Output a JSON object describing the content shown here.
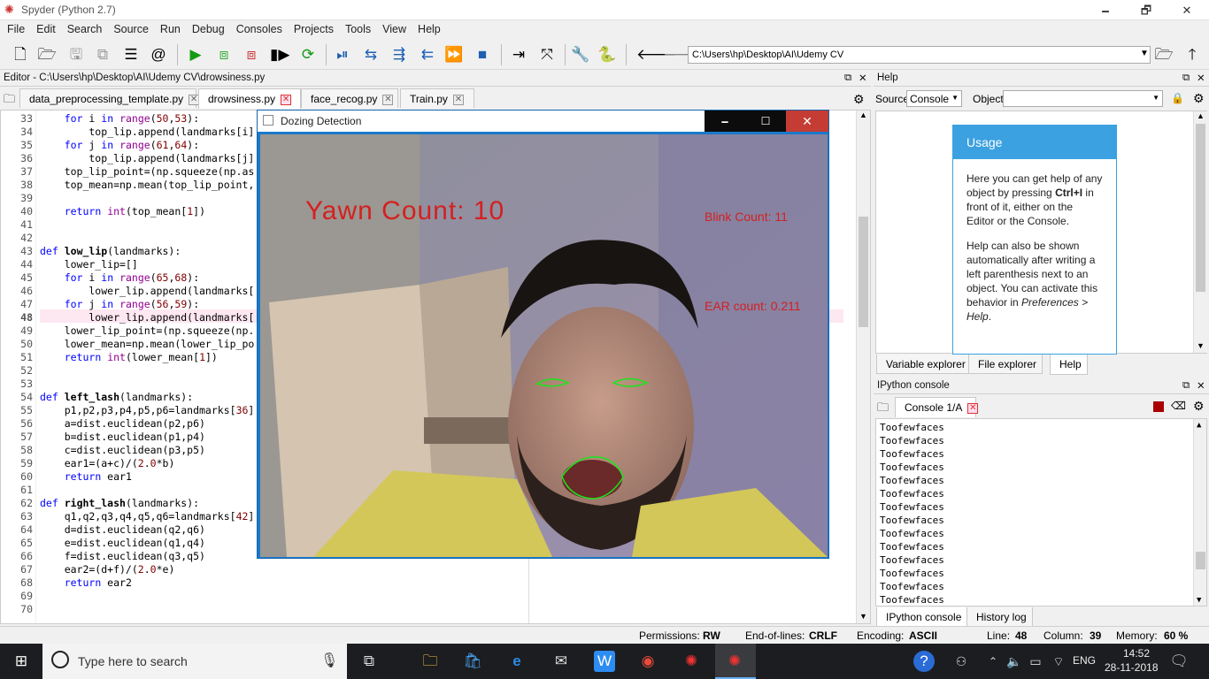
{
  "window": {
    "title": "Spyder (Python 2.7)",
    "minimize": "🗕",
    "maximize": "🗗",
    "close": "✕"
  },
  "menu": [
    "File",
    "Edit",
    "Search",
    "Source",
    "Run",
    "Debug",
    "Consoles",
    "Projects",
    "Tools",
    "View",
    "Help"
  ],
  "toolbar": {
    "path": "C:\\Users\\hp\\Desktop\\AI\\Udemy CV"
  },
  "editor": {
    "header": "Editor - C:\\Users\\hp\\Desktop\\AI\\Udemy CV\\drowsiness.py",
    "tabs": [
      "data_preprocessing_template.py",
      "drowsiness.py",
      "face_recog.py",
      "Train.py"
    ],
    "active_tab": 1,
    "current_line": 48,
    "lines": [
      {
        "n": "33",
        "t": "    for i in range(50,53):"
      },
      {
        "n": "34",
        "t": "        top_lip.append(landmarks[i]"
      },
      {
        "n": "35",
        "t": "    for j in range(61,64):"
      },
      {
        "n": "36",
        "t": "        top_lip.append(landmarks[j]"
      },
      {
        "n": "37",
        "t": "    top_lip_point=(np.squeeze(np.as"
      },
      {
        "n": "38",
        "t": "    top_mean=np.mean(top_lip_point,"
      },
      {
        "n": "39",
        "t": ""
      },
      {
        "n": "40",
        "t": "    return int(top_mean[1])"
      },
      {
        "n": "41",
        "t": ""
      },
      {
        "n": "42",
        "t": ""
      },
      {
        "n": "43",
        "t": "def low_lip(landmarks):"
      },
      {
        "n": "44",
        "t": "    lower_lip=[]"
      },
      {
        "n": "45",
        "t": "    for i in range(65,68):"
      },
      {
        "n": "46",
        "t": "        lower_lip.append(landmarks["
      },
      {
        "n": "47",
        "t": "    for j in range(56,59):"
      },
      {
        "n": "48",
        "t": "        lower_lip.append(landmarks["
      },
      {
        "n": "49",
        "t": "    lower_lip_point=(np.squeeze(np."
      },
      {
        "n": "50",
        "t": "    lower_mean=np.mean(lower_lip_po"
      },
      {
        "n": "51",
        "t": "    return int(lower_mean[1])"
      },
      {
        "n": "52",
        "t": ""
      },
      {
        "n": "53",
        "t": ""
      },
      {
        "n": "54",
        "t": "def left_lash(landmarks):"
      },
      {
        "n": "55",
        "t": "    p1,p2,p3,p4,p5,p6=landmarks[36]"
      },
      {
        "n": "56",
        "t": "    a=dist.euclidean(p2,p6)"
      },
      {
        "n": "57",
        "t": "    b=dist.euclidean(p1,p4)"
      },
      {
        "n": "58",
        "t": "    c=dist.euclidean(p3,p5)"
      },
      {
        "n": "59",
        "t": "    ear1=(a+c)/(2.0*b)"
      },
      {
        "n": "60",
        "t": "    return ear1"
      },
      {
        "n": "61",
        "t": ""
      },
      {
        "n": "62",
        "t": "def right_lash(landmarks):"
      },
      {
        "n": "63",
        "t": "    q1,q2,q3,q4,q5,q6=landmarks[42]"
      },
      {
        "n": "64",
        "t": "    d=dist.euclidean(q2,q6)"
      },
      {
        "n": "65",
        "t": "    e=dist.euclidean(q1,q4)"
      },
      {
        "n": "66",
        "t": "    f=dist.euclidean(q3,q5)"
      },
      {
        "n": "67",
        "t": "    ear2=(d+f)/(2.0*e)"
      },
      {
        "n": "68",
        "t": "    return ear2"
      },
      {
        "n": "69",
        "t": ""
      },
      {
        "n": "70",
        "t": ""
      }
    ]
  },
  "dozing": {
    "title": "Dozing Detection",
    "yawn": "Yawn Count: 10",
    "blink": "Blink Count: 11",
    "ear": "EAR count: 0.211",
    "min": "🗕",
    "max": "☐",
    "close": "✕"
  },
  "help": {
    "header": "Help",
    "source_label": "Source",
    "source_value": "Console",
    "object_label": "Object",
    "usage_title": "Usage",
    "p1a": "Here you can get help of any object by pressing ",
    "p1b": "Ctrl+I",
    "p1c": " in front of it, either on the Editor or the Console.",
    "p2a": "Help can also be shown automatically after writing a left parenthesis next to an object. You can activate this behavior in ",
    "p2b": "Preferences > Help",
    "p2c": ".",
    "tabs": [
      "Variable explorer",
      "File explorer",
      "Help"
    ]
  },
  "ipython": {
    "header": "IPython console",
    "tab": "Console 1/A",
    "output": [
      "Toofewfaces",
      "Toofewfaces",
      "Toofewfaces",
      "Toofewfaces",
      "Toofewfaces",
      "Toofewfaces",
      "Toofewfaces",
      "Toofewfaces",
      "Toofewfaces",
      "Toofewfaces",
      "Toofewfaces",
      "Toofewfaces",
      "Toofewfaces",
      "Toofewfaces"
    ],
    "tabs": [
      "IPython console",
      "History log"
    ]
  },
  "status": {
    "permissions_label": "Permissions:",
    "permissions": "RW",
    "eol_label": "End-of-lines:",
    "eol": "CRLF",
    "encoding_label": "Encoding:",
    "encoding": "ASCII",
    "line_label": "Line:",
    "line": "48",
    "column_label": "Column:",
    "column": "39",
    "memory_label": "Memory:",
    "memory": "60 %"
  },
  "taskbar": {
    "search_placeholder": "Type here to search",
    "lang": "ENG",
    "time": "14:52",
    "date": "28-11-2018"
  },
  "colors": {
    "accent": "#0078d7",
    "yawn_text": "#d42020",
    "eye_contour": "#19e619",
    "help_usage": "#3ba1e0"
  }
}
